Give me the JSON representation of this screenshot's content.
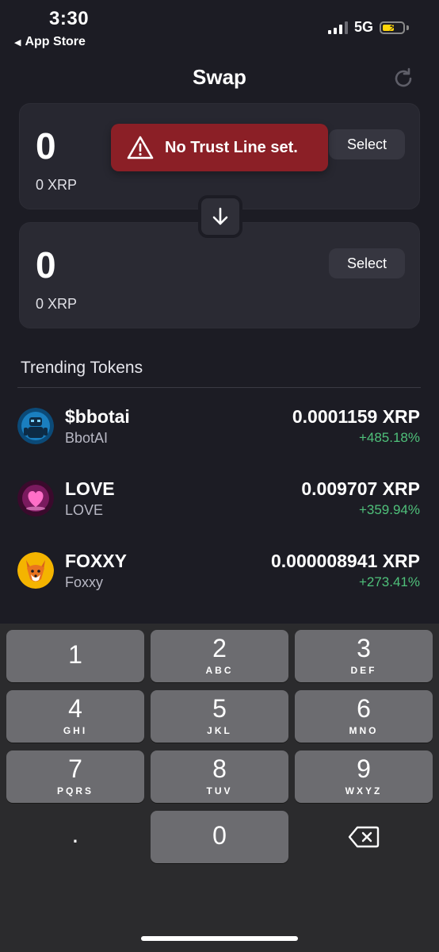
{
  "status_bar": {
    "time": "3:30",
    "back_label": "App Store",
    "network": "5G"
  },
  "header": {
    "title": "Swap"
  },
  "swap": {
    "from": {
      "amount": "0",
      "balance": "0 XRP",
      "select_label": "Select"
    },
    "to": {
      "amount": "0",
      "balance": "0 XRP",
      "select_label": "Select"
    }
  },
  "toast": {
    "message": "No Trust Line set.",
    "color": "#8b1f26"
  },
  "trending": {
    "title": "Trending Tokens",
    "tokens": [
      {
        "symbol": "$bbotai",
        "name": "BbotAI",
        "price": "0.0001159 XRP",
        "change": "+485.18%",
        "icon": "bbotai-robot-icon"
      },
      {
        "symbol": "LOVE",
        "name": "LOVE",
        "price": "0.009707 XRP",
        "change": "+359.94%",
        "icon": "love-heart-icon"
      },
      {
        "symbol": "FOXXY",
        "name": "Foxxy",
        "price": "0.000008941 XRP",
        "change": "+273.41%",
        "icon": "foxxy-fox-icon"
      }
    ],
    "positive_color": "#4fc07a"
  },
  "keyboard": {
    "keys": [
      {
        "num": "1",
        "letters": ""
      },
      {
        "num": "2",
        "letters": "ABC"
      },
      {
        "num": "3",
        "letters": "DEF"
      },
      {
        "num": "4",
        "letters": "GHI"
      },
      {
        "num": "5",
        "letters": "JKL"
      },
      {
        "num": "6",
        "letters": "MNO"
      },
      {
        "num": "7",
        "letters": "PQRS"
      },
      {
        "num": "8",
        "letters": "TUV"
      },
      {
        "num": "9",
        "letters": "WXYZ"
      },
      {
        "num": "0",
        "letters": ""
      }
    ],
    "decimal": "."
  }
}
